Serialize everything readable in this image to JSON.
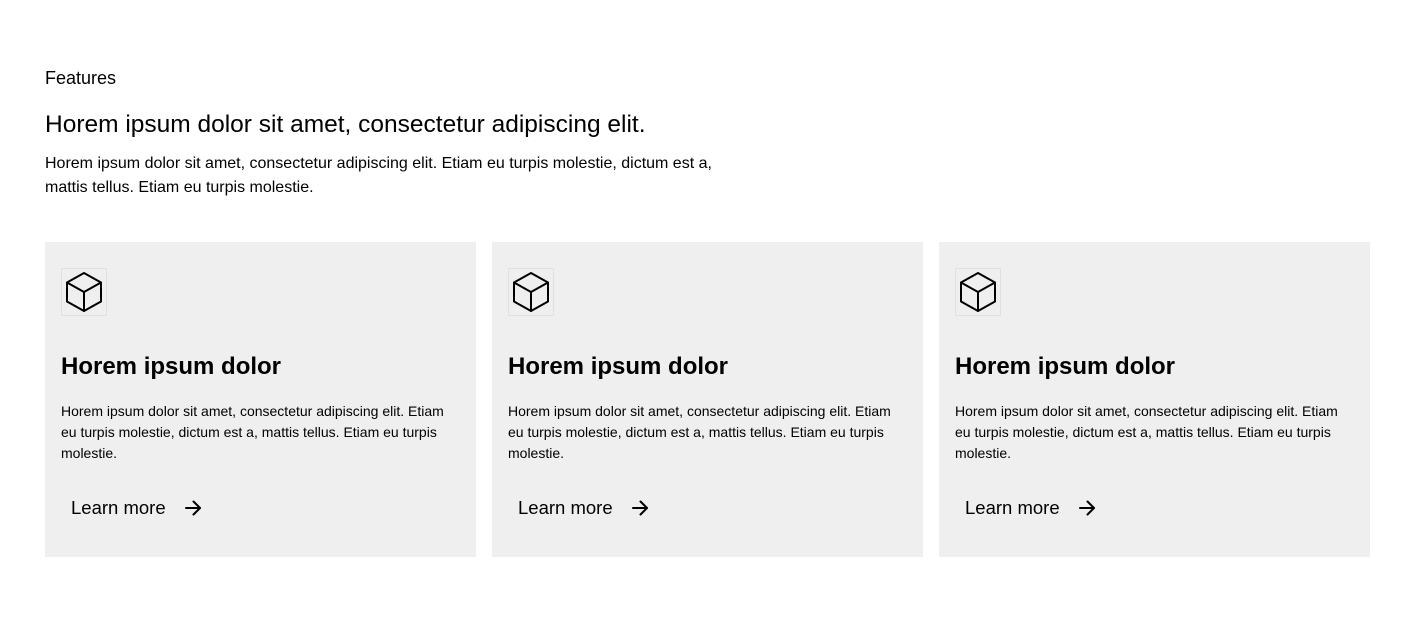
{
  "section": {
    "eyebrow": "Features",
    "headline": "Horem ipsum dolor sit amet, consectetur adipiscing elit.",
    "description": "Horem ipsum dolor sit amet, consectetur adipiscing elit. Etiam eu turpis molestie, dictum est a, mattis tellus. Etiam eu turpis molestie."
  },
  "cards": [
    {
      "icon": "cube-icon",
      "title": "Horem ipsum dolor",
      "body": "Horem ipsum dolor sit amet, consectetur adipiscing elit. Etiam eu turpis molestie, dictum est a, mattis tellus. Etiam eu turpis molestie.",
      "link_label": "Learn more",
      "link_icon": "arrow-right-icon"
    },
    {
      "icon": "cube-icon",
      "title": "Horem ipsum dolor",
      "body": "Horem ipsum dolor sit amet, consectetur adipiscing elit. Etiam eu turpis molestie, dictum est a, mattis tellus. Etiam eu turpis molestie.",
      "link_label": "Learn more",
      "link_icon": "arrow-right-icon"
    },
    {
      "icon": "cube-icon",
      "title": "Horem ipsum dolor",
      "body": "Horem ipsum dolor sit amet, consectetur adipiscing elit. Etiam eu turpis molestie, dictum est a, mattis tellus. Etiam eu turpis molestie.",
      "link_label": "Learn more",
      "link_icon": "arrow-right-icon"
    }
  ],
  "colors": {
    "card_background": "#efefef",
    "text": "#000000",
    "page_background": "#ffffff"
  }
}
